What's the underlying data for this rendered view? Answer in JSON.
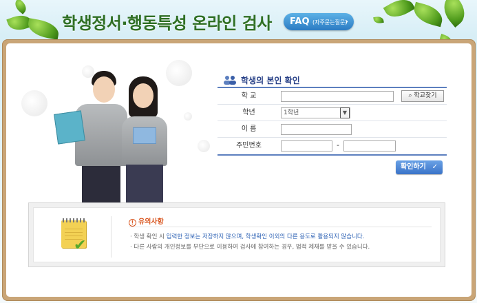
{
  "header": {
    "title": "학생정서·행동특성 온라인 검사",
    "faq_label": "FAQ",
    "faq_sub": "(자주묻는질문)",
    "faq_chevron": "›"
  },
  "form": {
    "title": "학생의 본인 확인",
    "rows": [
      {
        "label": "학 교",
        "value": "",
        "button": "학교찾기"
      },
      {
        "label": "학년",
        "selected": "1학년"
      },
      {
        "label": "이 름",
        "value": ""
      },
      {
        "label": "주민번호",
        "value_front": "",
        "separator": "-",
        "value_back": ""
      }
    ],
    "confirm_label": "확인하기",
    "confirm_check": "✓"
  },
  "notice": {
    "title": "유의사항",
    "line1_prefix": "학생 확인 시 ",
    "line1_highlight": "입력한 정보는 저장하지 않으며, 학생확인 이외의 다른 용도로 활용되지 않습니다.",
    "line2": "다른 사람의 개인정보를 무단으로 이용하여 검사에 참여하는 경우, 법적 제재를 받을 수 있습니다."
  },
  "icons": {
    "search": "search-icon",
    "people": "people-icon",
    "warning": "warning-icon",
    "notepad": "notepad-icon",
    "chevron_down": "chevron-down-icon"
  },
  "colors": {
    "title_green": "#2f6f24",
    "form_blue": "#263f86",
    "accent_blue": "#3a73c8",
    "warning_orange": "#d9551e",
    "frame_brown": "#c9a577"
  }
}
